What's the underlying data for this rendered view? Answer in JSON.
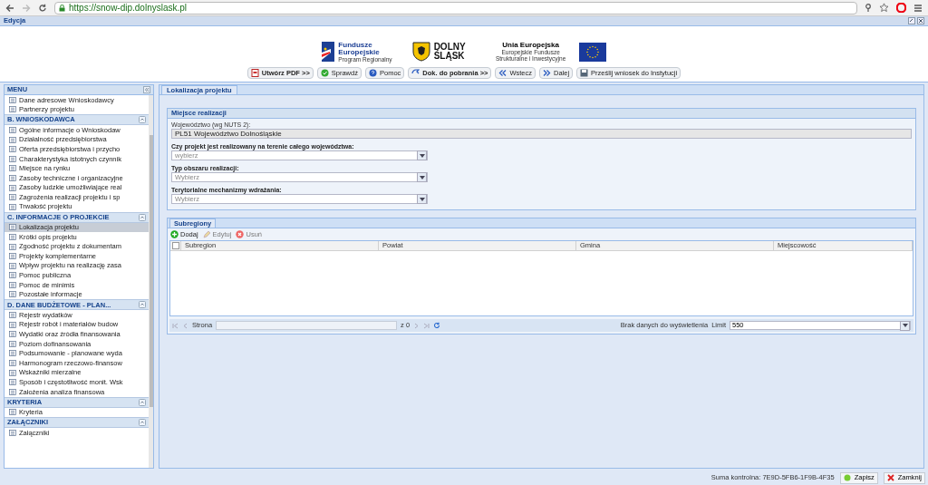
{
  "browser": {
    "url": "https://snow-dip.dolnyslask.pl"
  },
  "window": {
    "title": "Edycja"
  },
  "logos": {
    "fe_title": "Fundusze Europejskie",
    "fe_sub": "Program Regionalny",
    "ds_title": "DOLNY ŚLĄSK",
    "ue_title": "Unia Europejska",
    "ue_sub": "Europejskie Fundusze Strukturalne i Inwestycyjne"
  },
  "toolbar": [
    {
      "kind": "pdf",
      "label": "Utwórz PDF >>",
      "bold": true
    },
    {
      "kind": "check",
      "label": "Sprawdź",
      "bold": false
    },
    {
      "kind": "help",
      "label": "Pomoc",
      "bold": false
    },
    {
      "kind": "docs",
      "label": "Dok. do pobrania >>",
      "bold": true
    },
    {
      "kind": "back",
      "label": "Wstecz",
      "bold": false
    },
    {
      "kind": "next",
      "label": "Dalej",
      "bold": false
    },
    {
      "kind": "send",
      "label": "Prześlij wniosek do Instytucji",
      "bold": false
    }
  ],
  "sidebar": {
    "title": "MENU",
    "groups": [
      {
        "items": [
          {
            "label": "Dane adresowe Wnioskodawcy",
            "selected": false
          },
          {
            "label": "Partnerzy projektu",
            "selected": false
          }
        ]
      },
      {
        "title": "B. WNIOSKODAWCA",
        "items": [
          {
            "label": "Ogólne informacje o Wnioskodaw",
            "selected": false
          },
          {
            "label": "Działalność przedsiębiorstwa",
            "selected": false
          },
          {
            "label": "Oferta przedsiębiorstwa i przycho",
            "selected": false
          },
          {
            "label": "Charakterystyka istotnych czynnik",
            "selected": false
          },
          {
            "label": "Miejsce na rynku",
            "selected": false
          },
          {
            "label": "Zasoby techniczne i organizacyjne",
            "selected": false
          },
          {
            "label": "Zasoby ludzkie umożliwiające real",
            "selected": false
          },
          {
            "label": "Zagrożenia realizacji projektu i sp",
            "selected": false
          },
          {
            "label": "Trwałość projektu",
            "selected": false
          }
        ]
      },
      {
        "title": "C. INFORMACJE O PROJEKCIE",
        "items": [
          {
            "label": "Lokalizacja projektu",
            "selected": true
          },
          {
            "label": "Krótki opis projektu",
            "selected": false
          },
          {
            "label": "Zgodność projektu z dokumentam",
            "selected": false
          },
          {
            "label": "Projekty komplementarne",
            "selected": false
          },
          {
            "label": "Wpływ projektu na realizację zasa",
            "selected": false
          },
          {
            "label": "Pomoc publiczna",
            "selected": false
          },
          {
            "label": "Pomoc de minimis",
            "selected": false
          },
          {
            "label": "Pozostałe informacje",
            "selected": false
          }
        ]
      },
      {
        "title": "D. DANE BUDŻETOWE - PLAN...",
        "items": [
          {
            "label": "Rejestr wydatków",
            "selected": false
          },
          {
            "label": "Rejestr robót i materiałów budow",
            "selected": false
          },
          {
            "label": "Wydatki oraz źródła finansowania",
            "selected": false
          },
          {
            "label": "Poziom dofinansowania",
            "selected": false
          },
          {
            "label": "Podsumowanie - planowane wyda",
            "selected": false
          },
          {
            "label": "Harmonogram rzeczowo-finansow",
            "selected": false
          },
          {
            "label": "Wskaźniki mierzalne",
            "selected": false
          },
          {
            "label": "Sposób i częstotliwość monit. Wsk",
            "selected": false
          },
          {
            "label": "Założenia analiza finansowa",
            "selected": false
          }
        ]
      },
      {
        "title": "KRYTERIA",
        "items": [
          {
            "label": "Kryteria",
            "selected": false
          }
        ]
      },
      {
        "title": "ZAŁĄCZNIKI",
        "items": [
          {
            "label": "Załączniki",
            "selected": false
          }
        ]
      }
    ]
  },
  "main": {
    "tab": "Lokalizacja projektu",
    "section": {
      "title": "Miejsce realizacji",
      "region": {
        "label": "Województwo (wg NUTS 2):",
        "value": "PL51 Województwo Dolnośląskie"
      },
      "selects": [
        {
          "label": "Czy projekt jest realizowany na terenie całego województwa:",
          "placeholder": "wybierz"
        },
        {
          "label": "Typ obszaru realizacji:",
          "placeholder": "Wybierz"
        },
        {
          "label": "Terytorialne mechanizmy wdrażania:",
          "placeholder": "Wybierz"
        }
      ]
    },
    "grid": {
      "tab": "Subregiony",
      "actions": [
        {
          "kind": "add",
          "label": "Dodaj",
          "disabled": false
        },
        {
          "kind": "edit",
          "label": "Edytuj",
          "disabled": true
        },
        {
          "kind": "delete",
          "label": "Usuń",
          "disabled": true
        }
      ],
      "header_checkbox": {
        "checked": false
      },
      "columns": [
        "Subregion",
        "Powiat",
        "Gmina",
        "Miejscowość"
      ],
      "paging": {
        "page_label": "Strona",
        "of": "z 0",
        "status": "Brak danych do wyświetlenia",
        "limit_label": "Limit",
        "limit": "550"
      }
    }
  },
  "status_bar": {
    "checksum": "Suma kontrolna: 7E9D-5FB6-1F9B-4F35",
    "save": "Zapisz",
    "close": "Zamknij"
  }
}
